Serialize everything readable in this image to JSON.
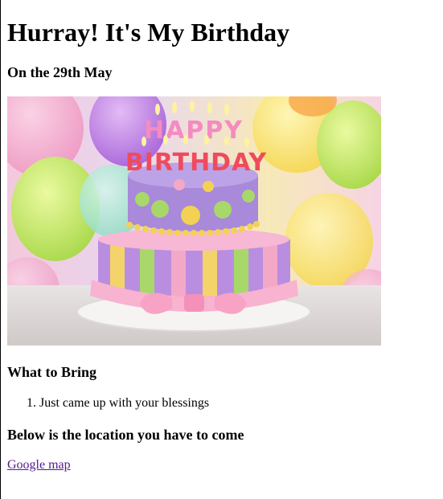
{
  "page": {
    "title": "Hurray! It's My Birthday",
    "subtitle": "On the 29th May"
  },
  "hero_image": {
    "icon": "birthday-cake-image",
    "candle_text_line1": "HAPPY",
    "candle_text_line2": "BIRTHDAY"
  },
  "bring_section": {
    "heading": "What to Bring",
    "items": [
      "Just came up with your blessings"
    ]
  },
  "location_section": {
    "heading": "Below is the location you have to come",
    "link_label": "Google map",
    "link_color": "#551a8b"
  }
}
